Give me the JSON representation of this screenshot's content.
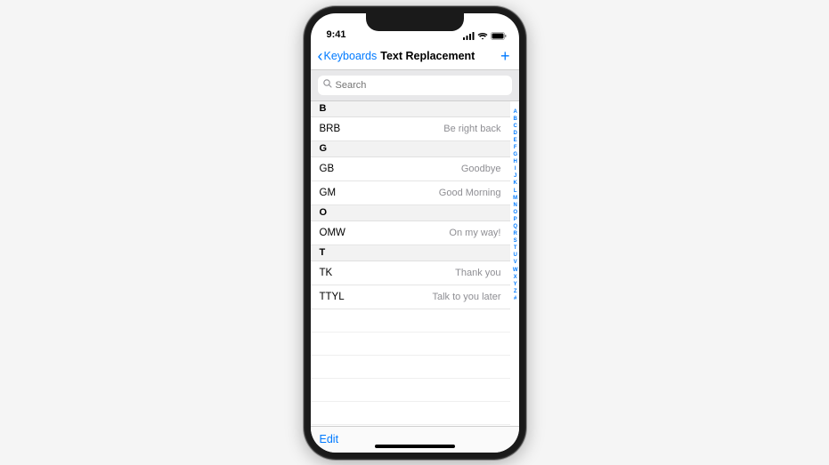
{
  "status": {
    "time": "9:41"
  },
  "nav": {
    "back_label": "Keyboards",
    "title": "Text Replacement",
    "add_label": "+"
  },
  "search": {
    "placeholder": "Search"
  },
  "sections": [
    {
      "letter": "B",
      "items": [
        {
          "shortcut": "BRB",
          "phrase": "Be right back"
        }
      ]
    },
    {
      "letter": "G",
      "items": [
        {
          "shortcut": "GB",
          "phrase": "Goodbye"
        },
        {
          "shortcut": "GM",
          "phrase": "Good Morning"
        }
      ]
    },
    {
      "letter": "O",
      "items": [
        {
          "shortcut": "OMW",
          "phrase": "On my way!"
        }
      ]
    },
    {
      "letter": "T",
      "items": [
        {
          "shortcut": "TK",
          "phrase": "Thank you"
        },
        {
          "shortcut": "TTYL",
          "phrase": "Talk to you later"
        }
      ]
    }
  ],
  "index_letters": [
    "A",
    "B",
    "C",
    "D",
    "E",
    "F",
    "G",
    "H",
    "I",
    "J",
    "K",
    "L",
    "M",
    "N",
    "O",
    "P",
    "Q",
    "R",
    "S",
    "T",
    "U",
    "V",
    "W",
    "X",
    "Y",
    "Z",
    "#"
  ],
  "toolbar": {
    "edit_label": "Edit"
  }
}
